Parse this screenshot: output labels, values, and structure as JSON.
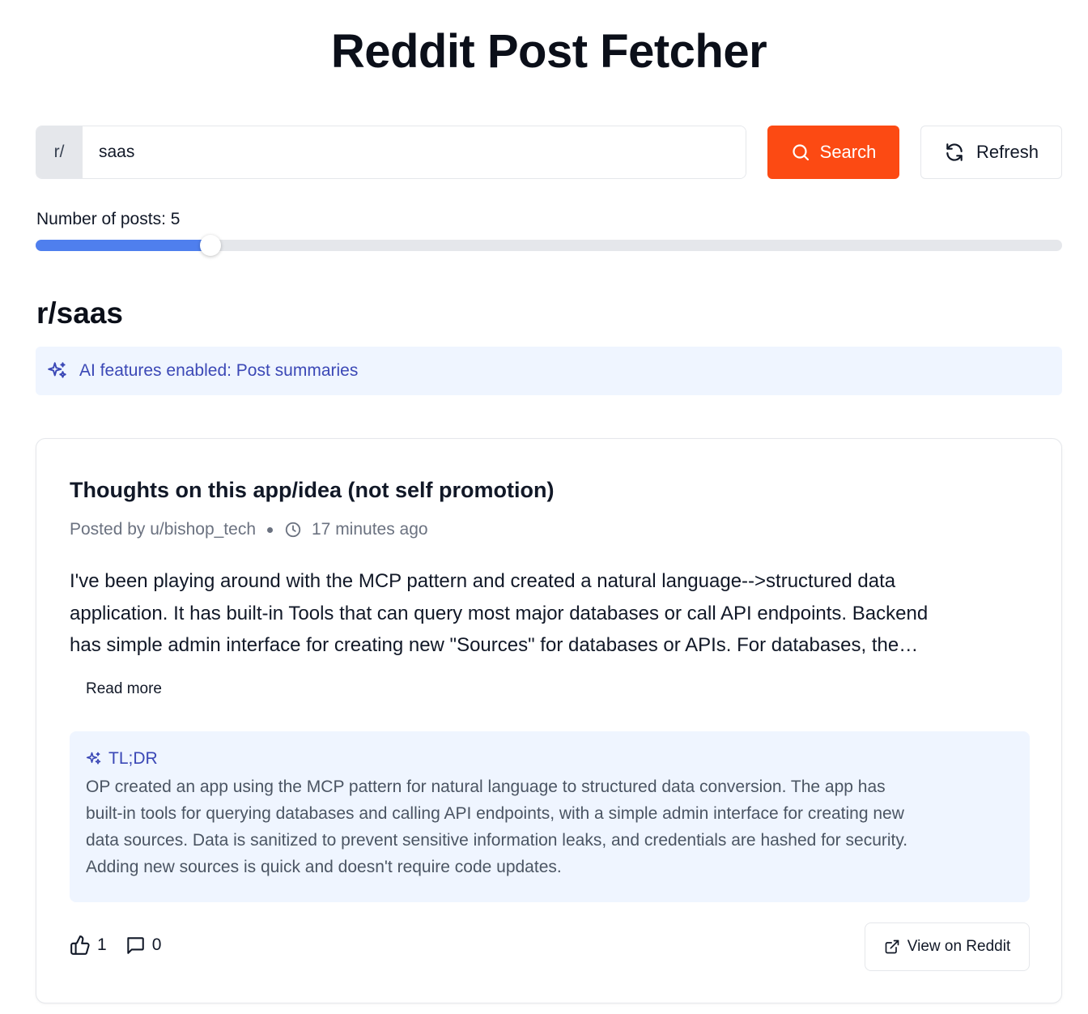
{
  "app": {
    "title": "Reddit Post Fetcher"
  },
  "search": {
    "prefix": "r/",
    "value": "saas",
    "search_label": "Search",
    "refresh_label": "Refresh",
    "search_icon": "search-icon",
    "refresh_icon": "refresh-icon"
  },
  "slider": {
    "label": "Number of posts: 5",
    "value": 5,
    "fill_fraction": 0.17
  },
  "subreddit": {
    "heading": "r/saas"
  },
  "ai_banner": {
    "text": "AI features enabled: Post summaries",
    "icon": "sparkles-icon"
  },
  "post": {
    "title": "Thoughts on this app/idea (not self promotion)",
    "author": "Posted by u/bishop_tech",
    "time": "17 minutes ago",
    "body_lines": [
      "I've been playing around with the MCP pattern and created a natural language-->structured data",
      "application. It has built-in Tools that can query most major databases or call API endpoints. Backend",
      "has simple admin interface for creating new \"Sources\" for databases or APIs. For databases, the…"
    ],
    "read_more": "Read more",
    "tldr_label": "TL;DR",
    "tldr_lines": [
      "OP created an app using the MCP pattern for natural language to structured data conversion. The app has",
      "built-in tools for querying databases and calling API endpoints, with a simple admin interface for creating new",
      "data sources. Data is sanitized to prevent sensitive information leaks, and credentials are hashed for security.",
      "Adding new sources is quick and doesn't require code updates."
    ],
    "upvotes": "1",
    "comments": "0",
    "view_label": "View on Reddit"
  },
  "colors": {
    "accent": "#fc4a13",
    "slider": "#4f7fee",
    "ai_text": "#3b48b6",
    "ai_bg": "#eff5ff"
  }
}
